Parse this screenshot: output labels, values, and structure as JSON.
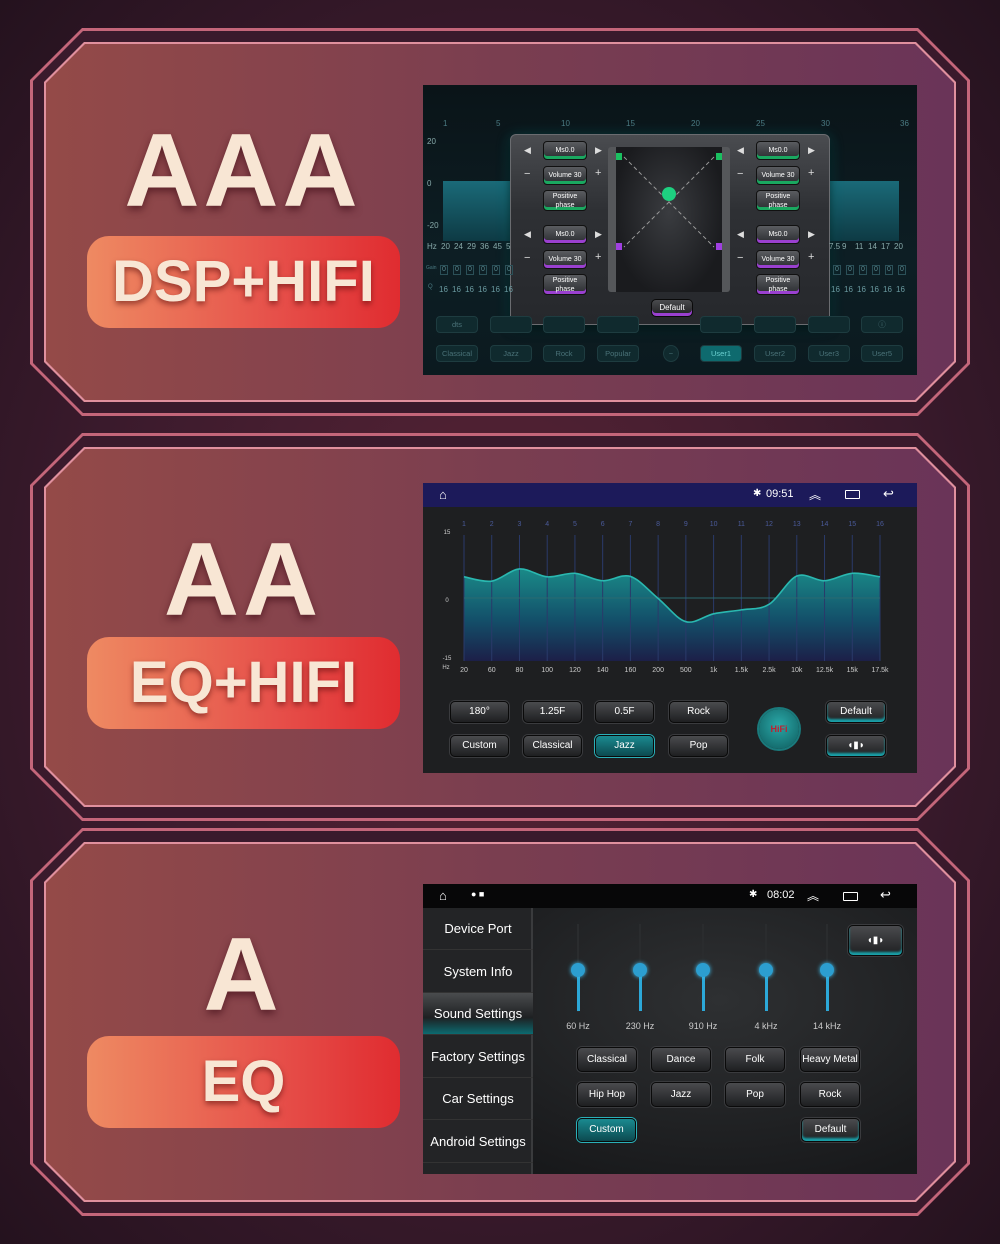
{
  "panels": [
    {
      "big": "AAA",
      "pill": "DSP+HIFI"
    },
    {
      "big": "AA",
      "pill": "EQ+HIFI"
    },
    {
      "big": "A",
      "pill": "EQ"
    }
  ],
  "dsp": {
    "band_numbers": [
      "1",
      "5",
      "10",
      "15",
      "20",
      "25",
      "30",
      "36"
    ],
    "y_labels": [
      "20",
      "0",
      "-20"
    ],
    "hz_label": "Hz",
    "hz_left": [
      "20",
      "24",
      "29",
      "36",
      "45",
      "5"
    ],
    "hz_right": [
      "7.5",
      "9",
      "11",
      "14",
      "17",
      "20"
    ],
    "gain_label": "Gain",
    "gain_value": "0",
    "q_label": "Q",
    "q_value": "16",
    "dts_label": "dts",
    "presets": [
      "Classical",
      "Jazz",
      "Rock",
      "Popular",
      "User1",
      "User2",
      "User3",
      "User5"
    ],
    "active_preset": "User1",
    "modal": {
      "channels": [
        {
          "delay": "Ms0.0",
          "volume": "Volume 30",
          "phase": "Positive phase",
          "color": "#1aa860"
        },
        {
          "delay": "Ms0.0",
          "volume": "Volume 30",
          "phase": "Positive phase",
          "color": "#1aa860"
        },
        {
          "delay": "Ms0.0",
          "volume": "Volume 30",
          "phase": "Positive phase",
          "color": "#9a40d0"
        },
        {
          "delay": "Ms0.0",
          "volume": "Volume 30",
          "phase": "Positive phase",
          "color": "#9a40d0"
        }
      ],
      "default_label": "Default"
    }
  },
  "eq16": {
    "status": {
      "time": "09:51",
      "icons": [
        "home-icon",
        "bluetooth-icon",
        "expand-up-icon",
        "recent-apps-icon",
        "back-icon"
      ]
    },
    "chart_data": {
      "type": "area",
      "band_numbers": [
        "1",
        "2",
        "3",
        "4",
        "5",
        "6",
        "7",
        "8",
        "9",
        "10",
        "11",
        "12",
        "13",
        "14",
        "15",
        "16"
      ],
      "categories": [
        "20",
        "60",
        "80",
        "100",
        "120",
        "140",
        "160",
        "200",
        "500",
        "1k",
        "1.5k",
        "2.5k",
        "10k",
        "12.5k",
        "15k",
        "17.5k"
      ],
      "values": [
        6.4,
        5.3,
        8.4,
        6.4,
        7.3,
        5.4,
        6.5,
        0.9,
        -5,
        -3,
        -2,
        -0.6,
        6.6,
        5.4,
        7.3,
        6.4
      ],
      "xlabel": "Hz",
      "ylim": [
        -15,
        15
      ],
      "y_ticks": [
        "15",
        "0",
        "-15"
      ],
      "color": "#2ab8b0"
    },
    "buttons_row1": [
      "180°",
      "1.25F",
      "0.5F",
      "Rock"
    ],
    "buttons_row2": [
      "Custom",
      "Classical",
      "Jazz",
      "Pop"
    ],
    "active": "Jazz",
    "hifi_label": "HiFi",
    "default_label": "Default"
  },
  "eq5": {
    "status": {
      "time": "08:02"
    },
    "sidebar": [
      "Device Port",
      "System Info",
      "Sound Settings",
      "Factory Settings",
      "Car Settings",
      "Android Settings"
    ],
    "active_sidebar": "Sound Settings",
    "sliders": [
      {
        "label": "60 Hz",
        "level": 0
      },
      {
        "label": "230 Hz",
        "level": 0
      },
      {
        "label": "910 Hz",
        "level": 0
      },
      {
        "label": "4 kHz",
        "level": 0
      },
      {
        "label": "14 kHz",
        "level": 0
      }
    ],
    "presets": [
      "Classical",
      "Dance",
      "Folk",
      "Heavy Metal",
      "Hip Hop",
      "Jazz",
      "Pop",
      "Rock"
    ],
    "custom_label": "Custom",
    "default_label": "Default",
    "active": "Custom"
  }
}
